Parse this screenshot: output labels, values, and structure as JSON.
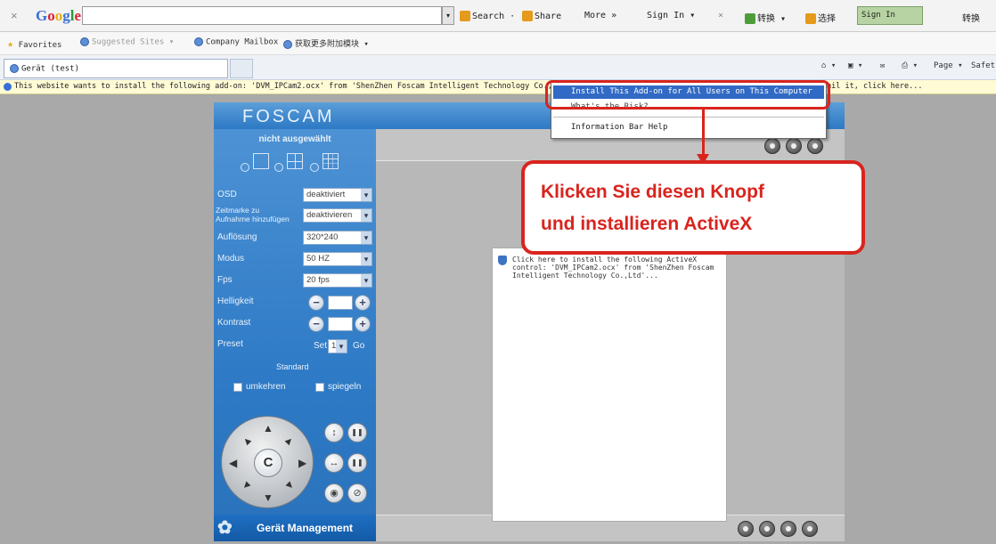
{
  "google_toolbar": {
    "close_glyph": "×",
    "logo": [
      "G",
      "o",
      "o",
      "g",
      "l",
      "e"
    ],
    "search_label": "Search ·",
    "share_label": "Share",
    "more_label": "More »",
    "signin_label": "Sign In",
    "signin_dropdown_glyph": "▾",
    "close2_glyph": "×",
    "ext1_label": "转换 ▾",
    "ext2_label": "选择",
    "green_signin_label": "Sign In",
    "far_right_label": "转换"
  },
  "favorites_bar": {
    "favorites_label": "Favorites",
    "suggested_label": "Suggested Sites ▾",
    "company_label": "Company Mailbox",
    "more_addons_label": "获取更多附加模块 ▾"
  },
  "tab_bar": {
    "tab_title": "Gerät (test)",
    "page_label": "Page ▾",
    "safety_label": "Safet"
  },
  "info_bar": {
    "message": "This website wants to install the following add-on: 'DVM_IPCam2.ocx' from 'ShenZhen Foscam Intelligent Technology Co.,Ltd'",
    "trailing": "ail it, click here..."
  },
  "context_menu": {
    "item_install": "Install This Add-on for All Users on This Computer",
    "item_risk": "What's the Risk?",
    "item_help": "Information Bar Help"
  },
  "app": {
    "logo": "FOSCAM",
    "camera_status": "nicht ausgewählt",
    "settings": {
      "osd_label": "OSD",
      "osd_value": "deaktiviert",
      "timestamp_label_1": "Zeitmarke zu",
      "timestamp_label_2": "Aufnahme hinzufügen",
      "timestamp_value": "deaktivieren",
      "resolution_label": "Auflösung",
      "resolution_value": "320*240",
      "mode_label": "Modus",
      "mode_value": "50 HZ",
      "fps_label": "Fps",
      "fps_value": "20 fps",
      "brightness_label": "Helligkeit",
      "contrast_label": "Kontrast",
      "preset_label": "Preset",
      "preset_set": "Set",
      "preset_value": "1",
      "preset_go": "Go",
      "standard_label": "Standard",
      "mirror_label": "spiegeln",
      "flip_label": "umkehren"
    },
    "dpad_center": "C",
    "management_label": "Gerät Management",
    "activex_prompt": "Click here to install the following ActiveX control: 'DVM_IPCam2.ocx' from 'ShenZhen Foscam Intelligent Technology Co.,Ltd'..."
  },
  "callout": {
    "line1": "Klicken  Sie  diesen  Knopf",
    "line2": "und  installieren  ActiveX"
  },
  "icons": {
    "minus": "−",
    "plus": "+",
    "arrow_up": "▲",
    "arrow_down": "▼",
    "arrow_left": "◀",
    "arrow_right": "▶",
    "vertical": "↕",
    "horizontal": "↔",
    "pause": "❚❚",
    "eye": "◉",
    "eye_off": "⊘",
    "gear": "✿",
    "star": "★",
    "dropdown": "▾"
  },
  "colors": {
    "accent_red": "#d9241e",
    "foscam_blue": "#2e7ac6",
    "menu_highlight": "#316ac5"
  }
}
